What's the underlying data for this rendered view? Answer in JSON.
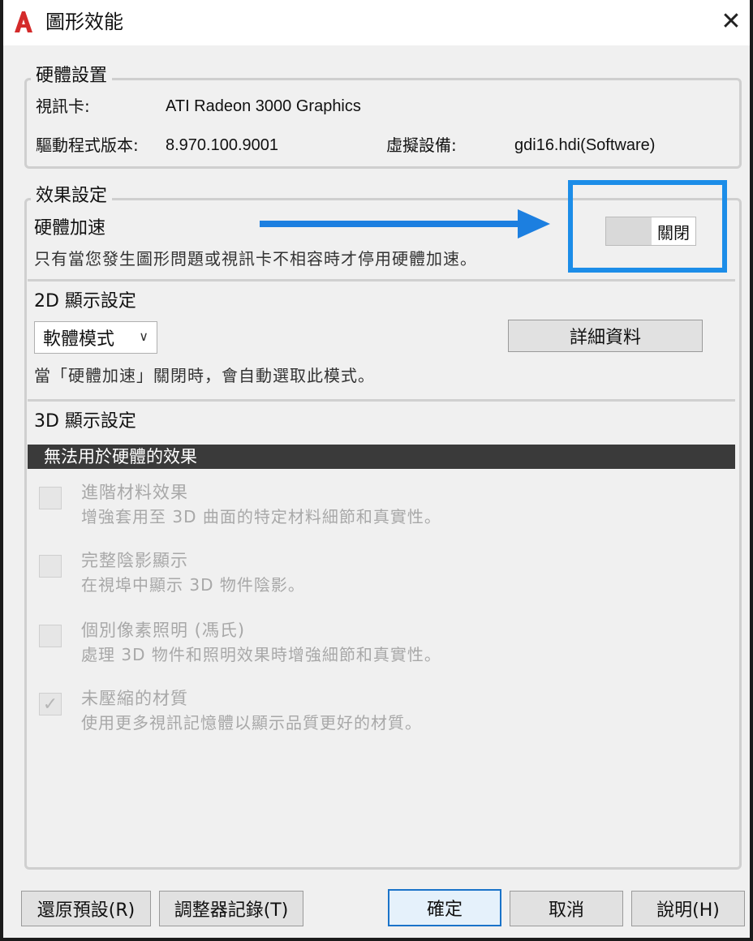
{
  "window": {
    "title": "圖形效能",
    "close_glyph": "✕",
    "app_icon": "autocad-a-icon"
  },
  "hardware": {
    "legend": "硬體設置",
    "video_card_label": "視訊卡:",
    "video_card_value": "ATI Radeon 3000 Graphics",
    "driver_label": "驅動程式版本:",
    "driver_value": "8.970.100.9001",
    "virtual_device_label": "虛擬設備:",
    "virtual_device_value": "gdi16.hdi(Software)"
  },
  "effects": {
    "legend": "效果設定",
    "hw_accel_title": "硬體加速",
    "hw_accel_desc": "只有當您發生圖形問題或視訊卡不相容時才停用硬體加速。",
    "toggle_label": "關閉",
    "toggle_state": "off"
  },
  "display2d": {
    "title": "2D 顯示設定",
    "mode_value": "軟體模式",
    "details_button": "詳細資料",
    "desc": "當「硬體加速」關閉時，會自動選取此模式。"
  },
  "display3d": {
    "title": "3D 顯示設定",
    "unavailable_header": "無法用於硬體的效果",
    "options": [
      {
        "title": "進階材料效果",
        "desc": "增強套用至 3D 曲面的特定材料細節和真實性。",
        "checked": false
      },
      {
        "title": "完整陰影顯示",
        "desc": "在視埠中顯示 3D 物件陰影。",
        "checked": false
      },
      {
        "title": "個別像素照明 (馮氏)",
        "desc": "處理 3D 物件和照明效果時增強細節和真實性。",
        "checked": false
      },
      {
        "title": "未壓縮的材質",
        "desc": "使用更多視訊記憶體以顯示品質更好的材質。",
        "checked": true
      }
    ]
  },
  "footer": {
    "restore_defaults": "還原預設(R)",
    "tuner_log": "調整器記錄(T)",
    "ok": "確定",
    "cancel": "取消",
    "help": "說明(H)"
  },
  "colors": {
    "highlight": "#1c8de8",
    "arrow": "#1c7fe0",
    "logo_red": "#d42b2b"
  }
}
